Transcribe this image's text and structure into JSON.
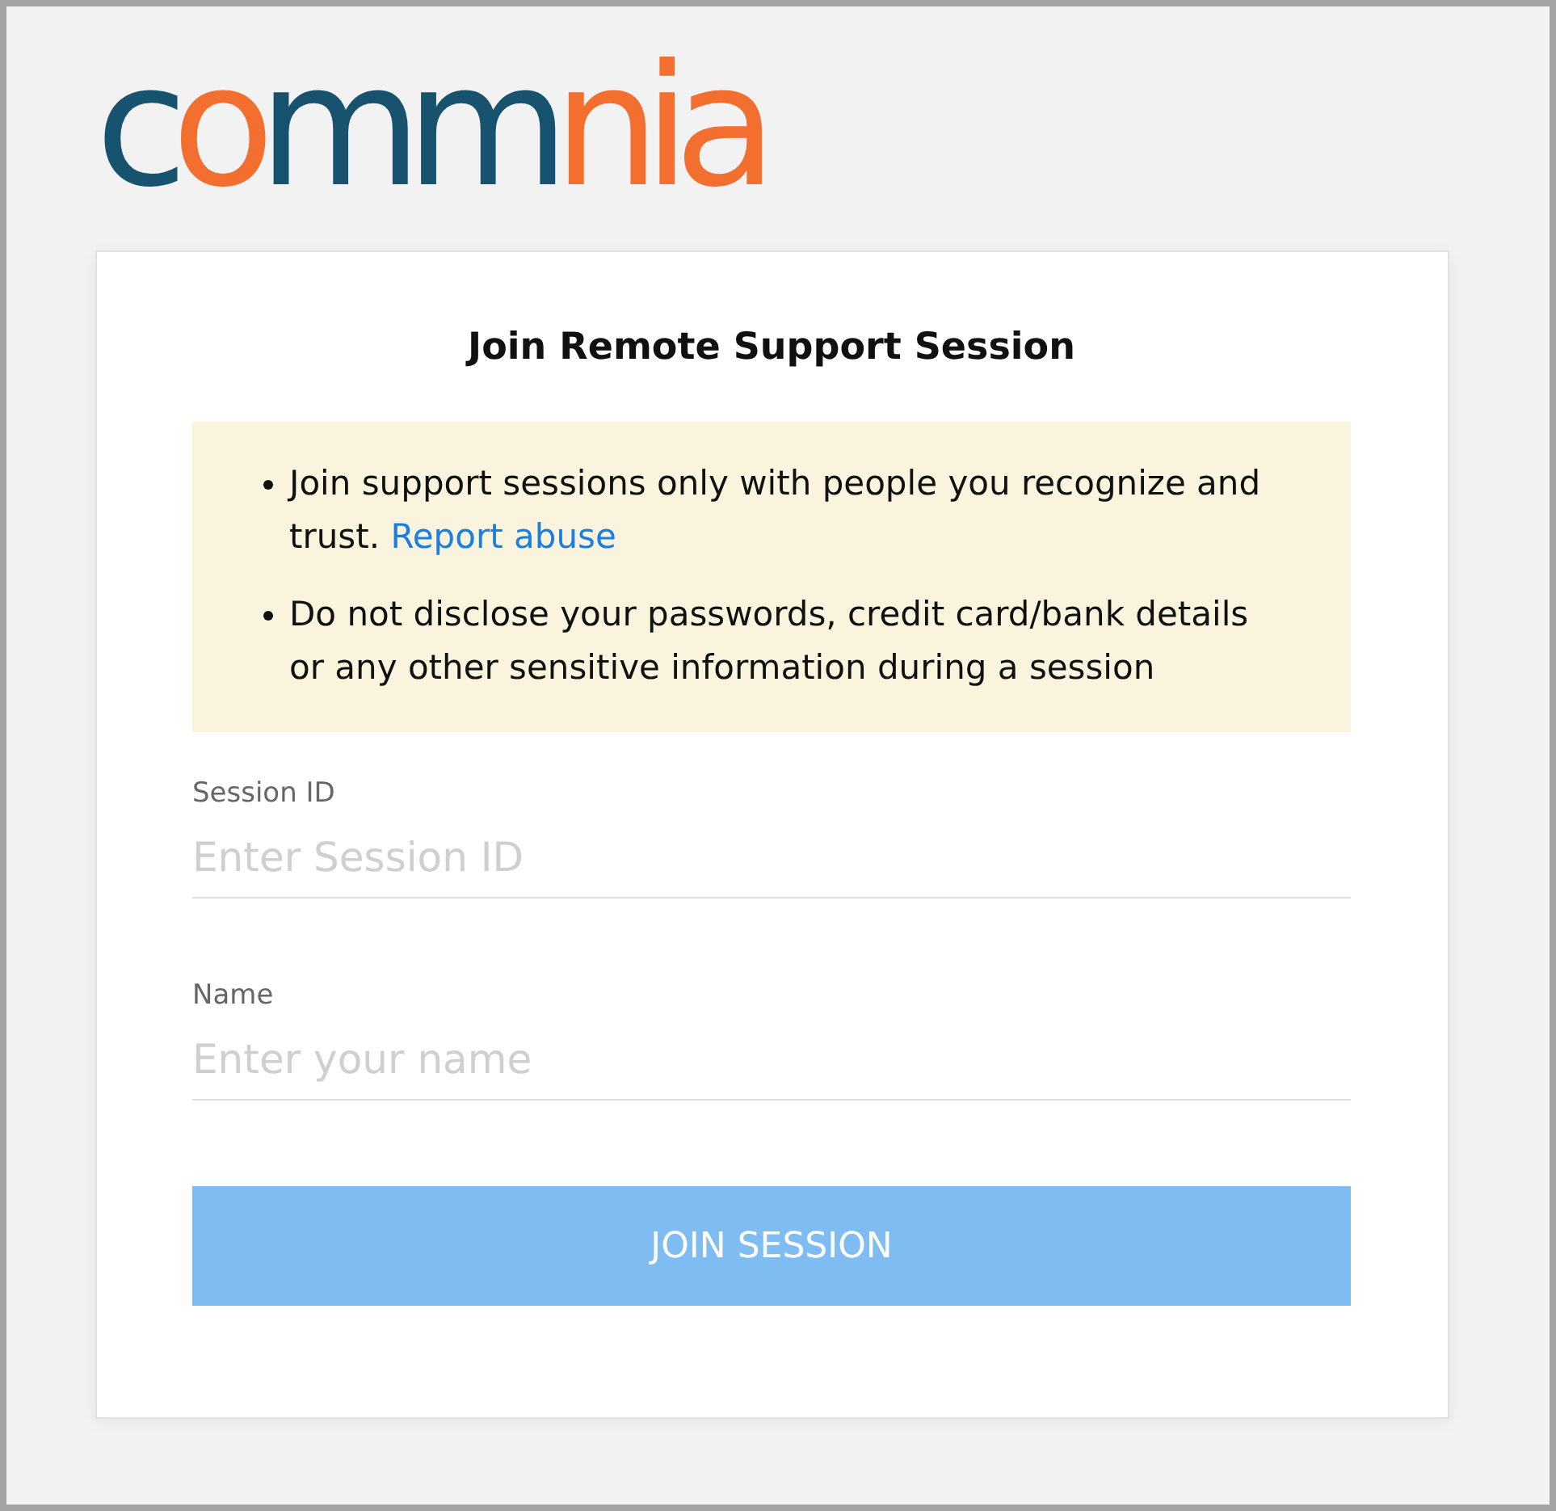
{
  "logo": {
    "parts": [
      {
        "text": "c",
        "color": "#17536f"
      },
      {
        "text": "o",
        "color": "#f26f2f"
      },
      {
        "text": "mm",
        "color": "#17536f"
      },
      {
        "text": "nia",
        "color": "#f26f2f"
      }
    ]
  },
  "card": {
    "title": "Join Remote Support Session",
    "notice": {
      "items": [
        {
          "text": "Join support sessions only with people you recognize and trust.",
          "link": "Report abuse"
        },
        {
          "text": "Do not disclose your passwords, credit card/bank details or any other sensitive information during a session"
        }
      ]
    },
    "fields": [
      {
        "label": "Session ID",
        "placeholder": "Enter Session ID"
      },
      {
        "label": "Name",
        "placeholder": "Enter your name"
      }
    ],
    "button": {
      "label": "JOIN SESSION",
      "disabled": true
    }
  }
}
